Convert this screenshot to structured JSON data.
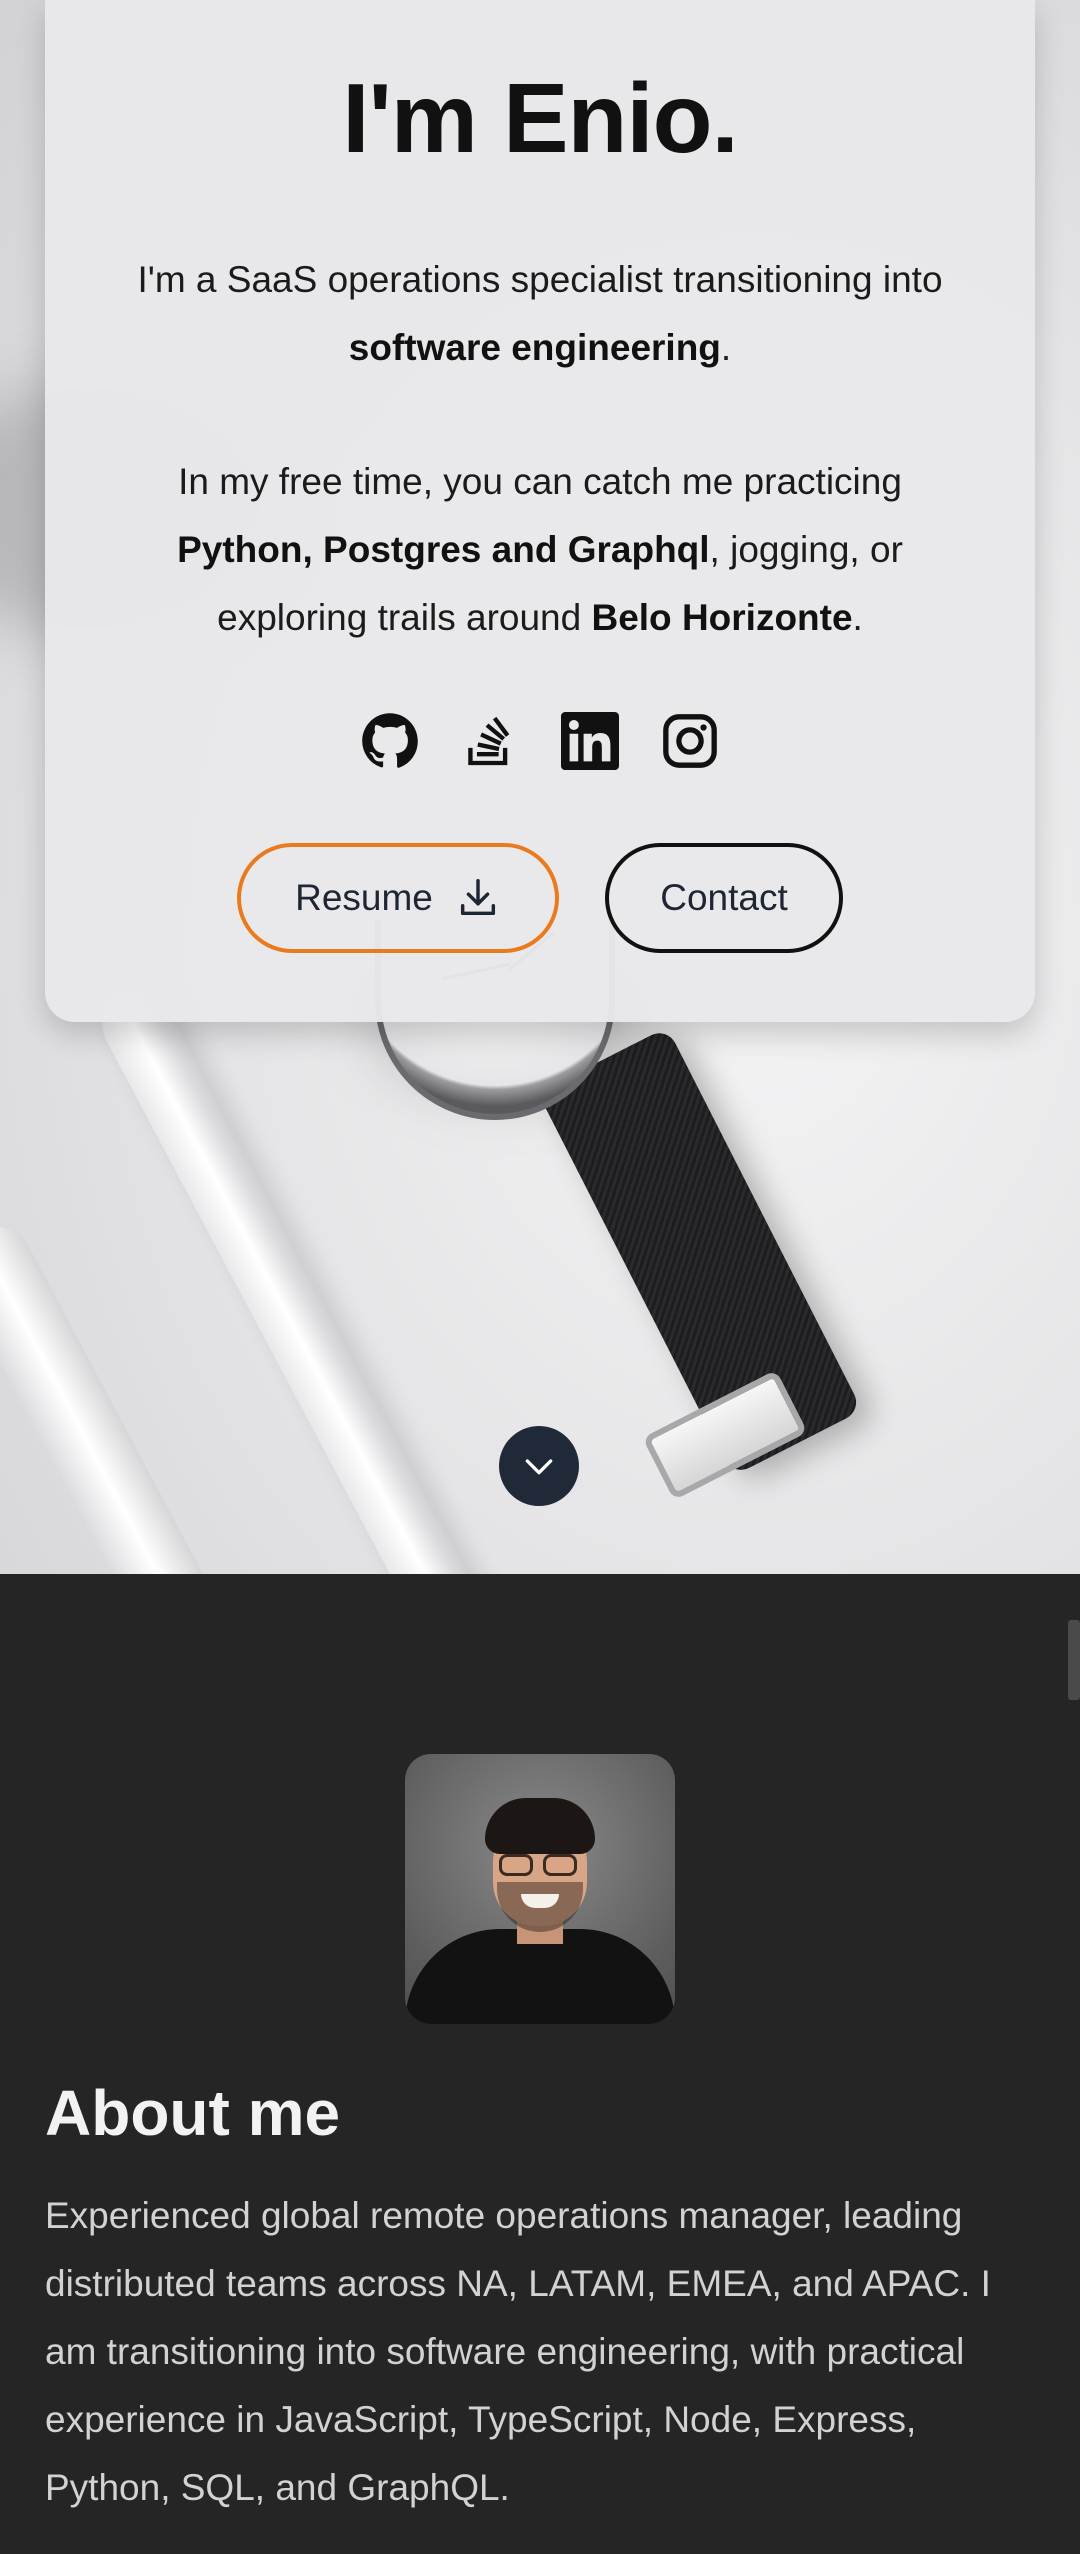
{
  "hero": {
    "title": "I'm Enio.",
    "intro_prefix": "I'm a SaaS operations specialist transitioning into ",
    "intro_bold": "software engineering",
    "intro_suffix": ".",
    "free_prefix": "In my free time, you can catch me practicing ",
    "free_bold1": "Python, Postgres and Graphql",
    "free_mid": ", jogging, or exploring trails around ",
    "free_bold2": "Belo Horizonte",
    "free_suffix": ".",
    "socials": [
      {
        "name": "github",
        "icon": "github-icon"
      },
      {
        "name": "stackoverflow",
        "icon": "stackoverflow-icon"
      },
      {
        "name": "linkedin",
        "icon": "linkedin-icon"
      },
      {
        "name": "instagram",
        "icon": "instagram-icon"
      }
    ],
    "resume_label": "Resume",
    "contact_label": "Contact",
    "accent_color": "#ea7a1e",
    "scroll_icon": "chevron-down-icon"
  },
  "about": {
    "title": "About me",
    "text": "Experienced global remote operations manager, leading distributed teams across NA, LATAM, EMEA, and APAC. I am transitioning into software engineering, with practical experience in JavaScript, TypeScript, Node, Express, Python, SQL, and GraphQL.",
    "background_color": "#252525"
  }
}
